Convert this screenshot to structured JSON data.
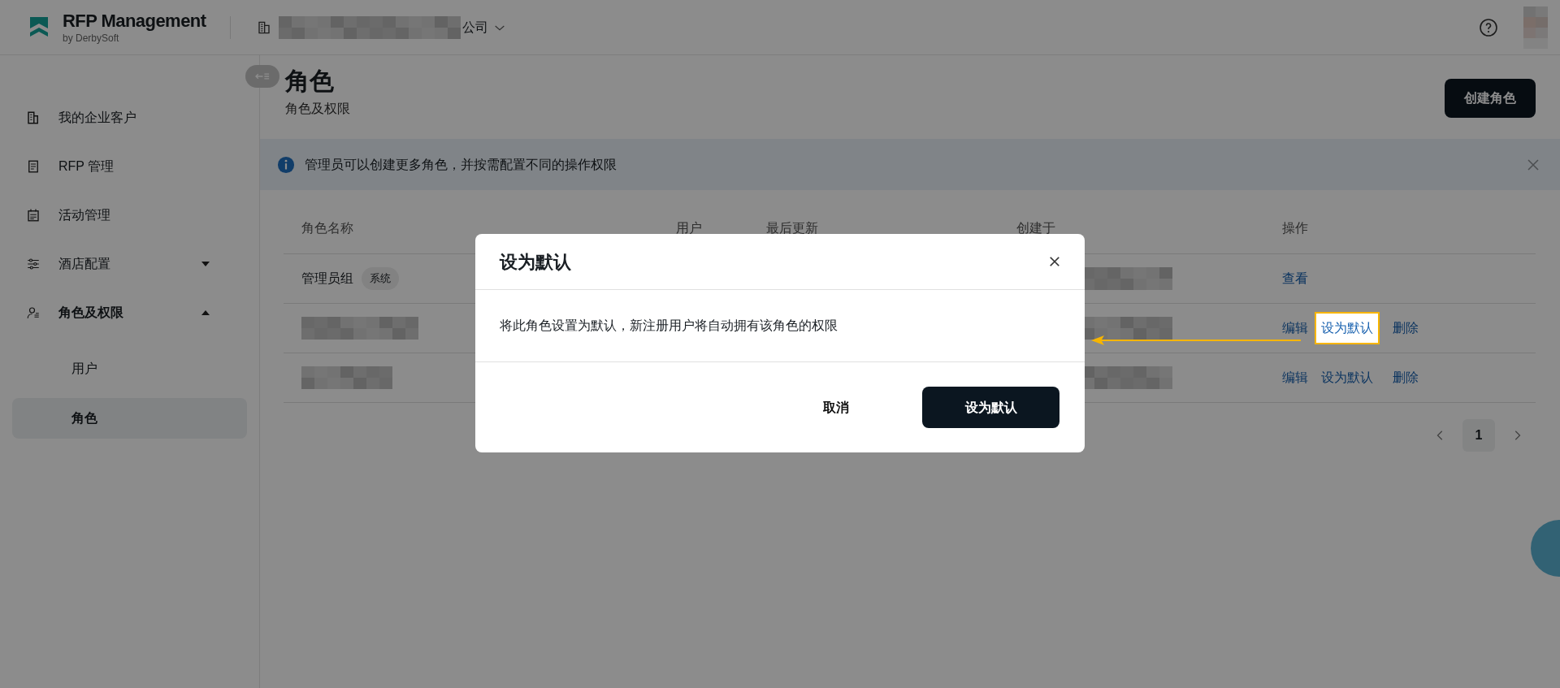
{
  "app": {
    "title": "RFP Management",
    "subtitle": "by DerbySoft"
  },
  "header": {
    "company_suffix": "公司"
  },
  "sidebar": {
    "items": [
      {
        "label": "我的企业客户"
      },
      {
        "label": "RFP 管理"
      },
      {
        "label": "活动管理"
      },
      {
        "label": "酒店配置",
        "expanded": false
      },
      {
        "label": "角色及权限",
        "expanded": true,
        "children": [
          {
            "label": "用户",
            "selected": false
          },
          {
            "label": "角色",
            "selected": true
          }
        ]
      }
    ]
  },
  "page": {
    "title": "角色",
    "subtitle": "角色及权限",
    "primary_button": "创建角色"
  },
  "notice": {
    "text": "管理员可以创建更多角色，并按需配置不同的操作权限"
  },
  "table": {
    "columns": [
      "角色名称",
      "用户",
      "最后更新",
      "创建于",
      "操作"
    ],
    "rows": [
      {
        "name": "管理员组",
        "tag": "系统",
        "actions": [
          {
            "label": "查看",
            "highlighted": false
          }
        ]
      },
      {
        "actions": [
          {
            "label": "编辑",
            "highlighted": false
          },
          {
            "label": "设为默认",
            "highlighted": true
          },
          {
            "label": "删除",
            "highlighted": false
          }
        ]
      },
      {
        "actions": [
          {
            "label": "编辑",
            "highlighted": false
          },
          {
            "label": "设为默认",
            "highlighted": false
          },
          {
            "label": "删除",
            "highlighted": false
          }
        ]
      }
    ]
  },
  "pagination": {
    "pages": [
      {
        "label": "1",
        "selected": true
      }
    ]
  },
  "dialog": {
    "title": "设为默认",
    "message": "将此角色设置为默认，新注册用户将自动拥有该角色的权限",
    "buttons": [
      {
        "label": "取消",
        "kind": "secondary"
      },
      {
        "label": "设为默认",
        "kind": "primary"
      }
    ]
  }
}
